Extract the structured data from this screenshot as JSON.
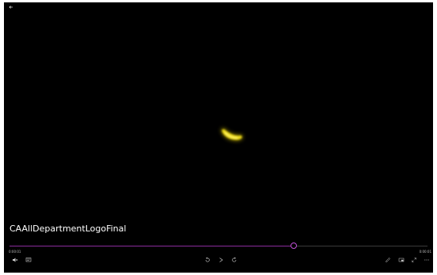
{
  "video": {
    "title": "CAAllDepartmentLogoFinal"
  },
  "playback": {
    "time_elapsed": "0:00:01",
    "time_total": "0:00:01",
    "progress": 0.68
  },
  "colors": {
    "background": "#000000",
    "accent": "#c04fd6",
    "glow": "#f5e21a"
  },
  "icons": {
    "back": "back-arrow-icon",
    "volume": "volume-icon",
    "captions": "captions-icon",
    "rewind": "skip-back-icon",
    "play": "play-icon",
    "forward": "skip-forward-icon",
    "edit": "edit-pencil-icon",
    "miniview": "mini-view-icon",
    "fullscreen": "fullscreen-icon",
    "more": "more-options-icon"
  }
}
